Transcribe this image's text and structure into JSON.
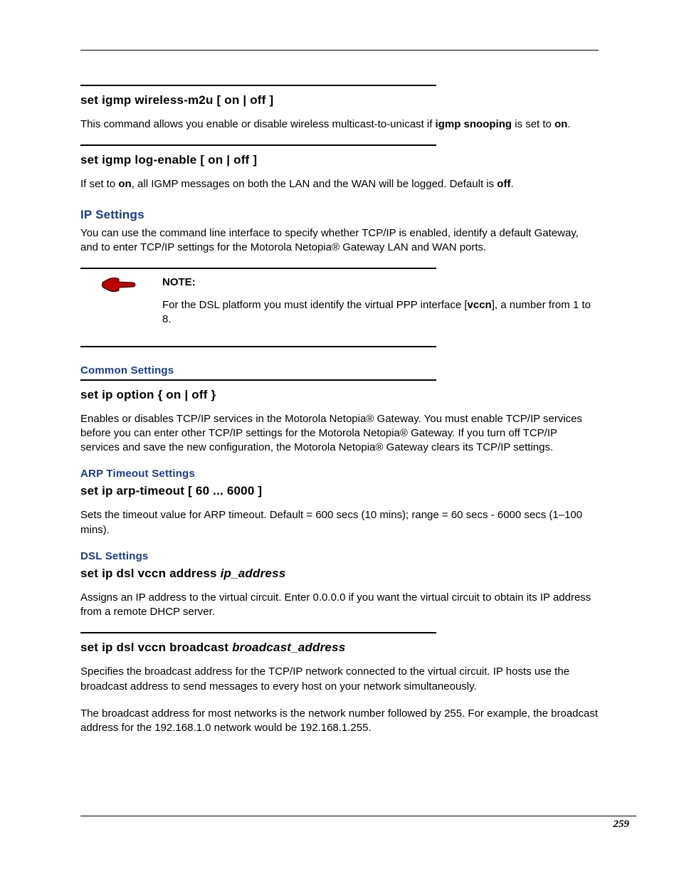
{
  "page_number": "259",
  "sections": [
    {
      "type": "cmd",
      "heading": "set igmp wireless-m2u [ on | off ]",
      "body_html": "This command allows you enable or disable wireless multicast-to-unicast if <b>igmp snooping</b> is set to <b>on</b>."
    },
    {
      "type": "cmd",
      "heading": "set igmp log-enable [ on | off ]",
      "body_html": "If set to <b>on</b>, all IGMP messages on both the LAN and the WAN will be logged. Default is <b>off</b>."
    },
    {
      "type": "section",
      "heading": "IP Settings",
      "body_html": "You can use the command line interface to specify whether TCP/IP is enabled, identify a default Gateway, and to enter TCP/IP settings for the Motorola Netopia® Gateway LAN and WAN ports."
    },
    {
      "type": "note",
      "label": "NOTE:",
      "body_html": "For the DSL platform you must identify the virtual PPP interface [<b>vccn</b>], a number from 1 to 8."
    },
    {
      "type": "subsection",
      "heading": "Common Settings"
    },
    {
      "type": "cmd",
      "heading": "set ip option { on | off }",
      "body_html": "Enables or disables TCP/IP services in the Motorola Netopia® Gateway. You must enable TCP/IP services before you can enter other TCP/IP settings for the Motorola Netopia® Gateway. If you turn off TCP/IP services and save the new configuration, the Motorola Netopia® Gateway clears its TCP/IP settings."
    },
    {
      "type": "subsection",
      "heading": "ARP Timeout Settings"
    },
    {
      "type": "cmd_norule",
      "heading": "set ip arp-timeout [ 60 ... 6000 ]",
      "body_html": "Sets the timeout value for ARP timeout. Default = 600 secs (10 mins); range = 60 secs - 6000 secs (1–100 mins)."
    },
    {
      "type": "subsection",
      "heading": "DSL Settings"
    },
    {
      "type": "cmd_norule_italic",
      "heading_prefix": "set ip dsl vccn address ",
      "heading_italic": "ip_address",
      "body_html": "Assigns an IP address to the virtual circuit. Enter 0.0.0.0 if you want the virtual circuit to obtain its IP address from a remote DHCP server."
    },
    {
      "type": "cmd_italic",
      "heading_prefix": "set ip dsl vccn broadcast ",
      "heading_italic": "broadcast_address",
      "body_html": "Specifies the broadcast address for the TCP/IP network connected to the virtual circuit. IP hosts use the broadcast address to send messages to every host on your network simultaneously."
    },
    {
      "type": "para",
      "body_html": "The broadcast address for most networks is the network number followed by 255. For example, the broadcast address for the 192.168.1.0 network would be 192.168.1.255."
    }
  ]
}
